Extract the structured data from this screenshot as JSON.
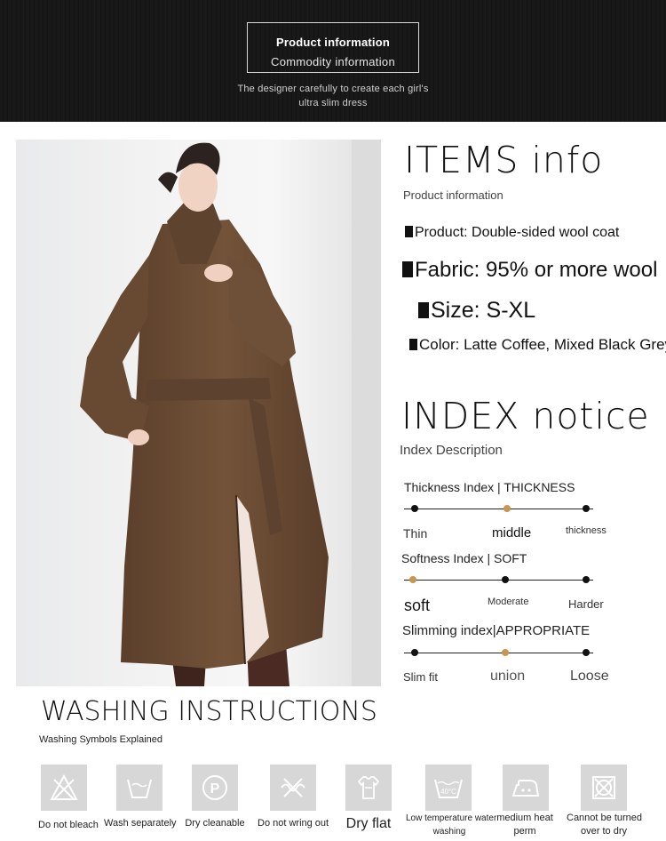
{
  "banner": {
    "title": "Product information",
    "subtitle": "Commodity information",
    "tagline_line1": "The designer  carefully to create each girl's",
    "tagline_line2": "ultra slim dress"
  },
  "items": {
    "heading": "ITEMS  info",
    "subheading": "Product information",
    "product": "Product: Double-sided wool coat",
    "fabric": "Fabric: 95% or more wool",
    "size": "Size: S-XL",
    "color": "Color: Latte Coffee, Mixed Black Grey"
  },
  "index": {
    "heading": "INDEX  notice",
    "subheading": "Index Description",
    "scales": [
      {
        "title": "Thickness Index | THICKNESS",
        "labels": [
          "Thin",
          "middle",
          "thickness"
        ],
        "selected": "middle"
      },
      {
        "title": "Softness Index | SOFT",
        "labels": [
          "soft",
          "Moderate",
          "Harder"
        ],
        "selected": "soft"
      },
      {
        "title": "Slimming index|APPROPRIATE",
        "labels": [
          "Slim fit",
          "union",
          "Loose"
        ],
        "selected": "union"
      }
    ]
  },
  "washing": {
    "heading": "WASHING  INSTRUCTIONS",
    "subheading": "Washing Symbols Explained",
    "symbols": [
      {
        "icon": "no-bleach-icon",
        "label": "Do not bleach"
      },
      {
        "icon": "wash-separately-icon",
        "label": "Wash separately"
      },
      {
        "icon": "dry-clean-icon",
        "label": "Dry cleanable"
      },
      {
        "icon": "no-wring-icon",
        "label": "Do not wring out"
      },
      {
        "icon": "dry-flat-icon",
        "label": "Dry flat"
      },
      {
        "icon": "low-temp-wash-icon",
        "label_line1": "Low temperature water",
        "label_line2": "washing",
        "badge": "40°C"
      },
      {
        "icon": "medium-heat-iron-icon",
        "label_line1": "medium heat",
        "label_line2": "perm"
      },
      {
        "icon": "no-tumble-dry-icon",
        "label_line1": "Cannot be turned",
        "label_line2": "over to dry"
      }
    ]
  },
  "colors": {
    "banner_bg": "#161616",
    "accent_dot": "#c8964c",
    "coat": "#6b4c35",
    "icon_bg": "#d7d7d7"
  }
}
